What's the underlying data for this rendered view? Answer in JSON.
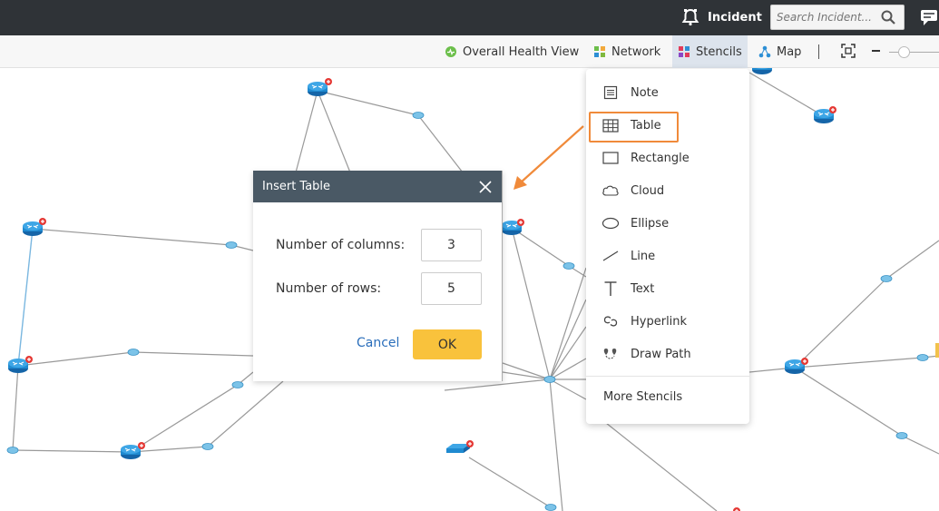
{
  "topbar": {
    "incident_label": "Incident",
    "search_placeholder": "Search Incident...",
    "incident_icon": "bell-icon",
    "search_icon": "magnifier-icon",
    "chat_icon": "chat-icon"
  },
  "toolbar": {
    "overall_health": "Overall Health View",
    "network": "Network",
    "stencils": "Stencils",
    "map": "Map",
    "zoom_icon": "fit-screen-icon"
  },
  "stencils_menu": {
    "items": [
      {
        "label": "Note",
        "icon": "note-icon"
      },
      {
        "label": "Table",
        "icon": "table-icon"
      },
      {
        "label": "Rectangle",
        "icon": "rectangle-icon"
      },
      {
        "label": "Cloud",
        "icon": "cloud-icon"
      },
      {
        "label": "Ellipse",
        "icon": "ellipse-icon"
      },
      {
        "label": "Line",
        "icon": "line-icon"
      },
      {
        "label": "Text",
        "icon": "text-icon"
      },
      {
        "label": "Hyperlink",
        "icon": "hyperlink-icon"
      },
      {
        "label": "Draw Path",
        "icon": "draw-path-icon"
      }
    ],
    "more": "More Stencils"
  },
  "dialog": {
    "title": "Insert Table",
    "columns_label": "Number of columns:",
    "columns_value": "3",
    "rows_label": "Number of rows:",
    "rows_value": "5",
    "cancel": "Cancel",
    "ok": "OK"
  },
  "colors": {
    "topbar": "#2f3337",
    "toolbar": "#f7f7f7",
    "stencils_active": "#dde4ed",
    "dialog_header": "#4a5965",
    "ok_button": "#f9c23c",
    "highlight": "#f08a3a",
    "link": "#2a6ebb",
    "router": "#1f8ad0",
    "edge": "#999999"
  }
}
